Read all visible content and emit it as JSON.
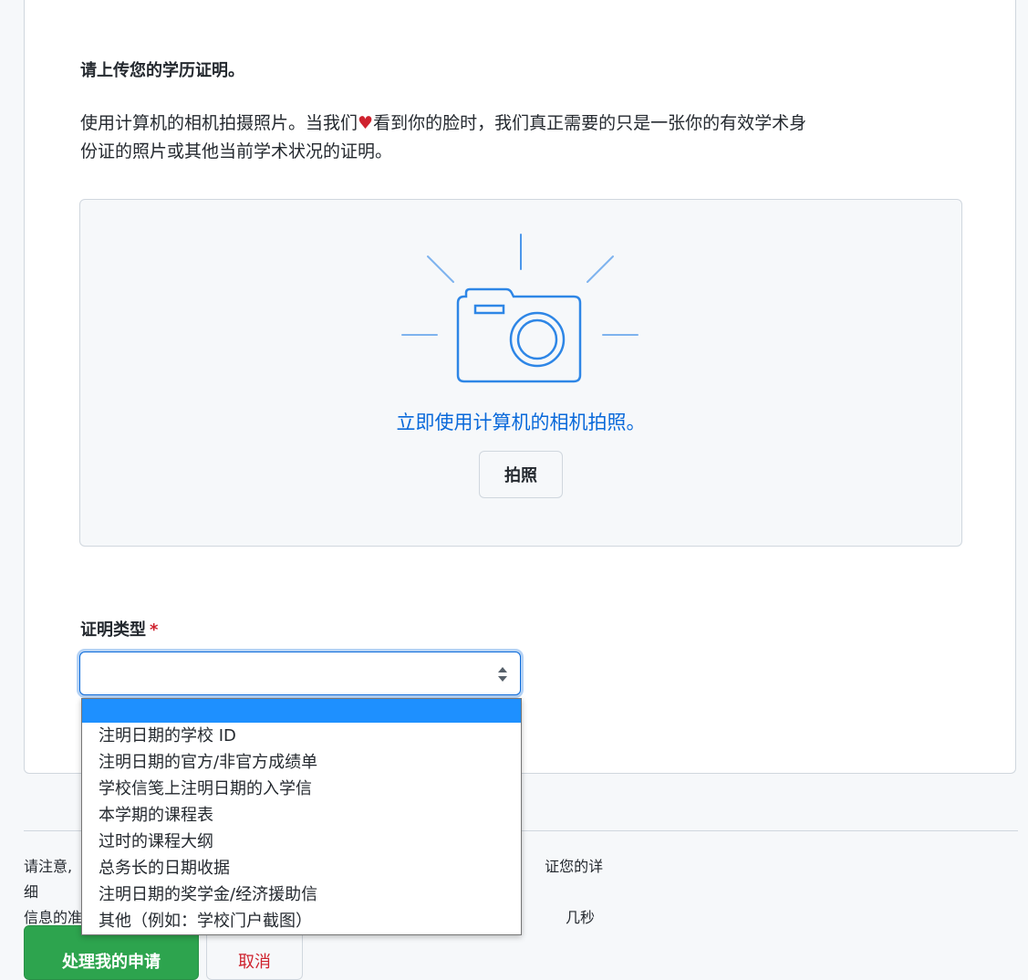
{
  "upload": {
    "heading": "请上传您的学历证明。",
    "desc_before_heart": "使用计算机的相机拍摄照片。当我们",
    "heart": "♥",
    "desc_after_heart": "看到你的脸时，我们真正需要的只是一张你的有效学术身份证的照片或其他当前学术状况的证明。"
  },
  "camera": {
    "icon": "camera-icon",
    "prompt": "立即使用计算机的相机拍照。",
    "button_label": "拍照",
    "accent_color": "#2e86e6"
  },
  "proof_type": {
    "label": "证明类型",
    "required_mark": "*",
    "selected": "",
    "options": [
      "",
      "注明日期的学校 ID",
      "注明日期的官方/非官方成绩单",
      "学校信笺上注明日期的入学信",
      "本学期的课程表",
      "过时的课程大纲",
      "总务长的日期收据",
      "注明日期的奖学金/经济援助信",
      "其他（例如：学校门户截图）"
    ]
  },
  "footer": {
    "note_line1_visible": "请注意,",
    "note_line1_tail": "证您的详细",
    "note_line2_visible": "信息的准",
    "note_line2_tail": "几秒钟。",
    "submit_label": "处理我的申请",
    "cancel_label": "取消"
  },
  "colors": {
    "link_blue": "#0969da",
    "required_red": "#cf222e",
    "selected_option": "#1e90ff",
    "submit_green": "#2da44e"
  }
}
